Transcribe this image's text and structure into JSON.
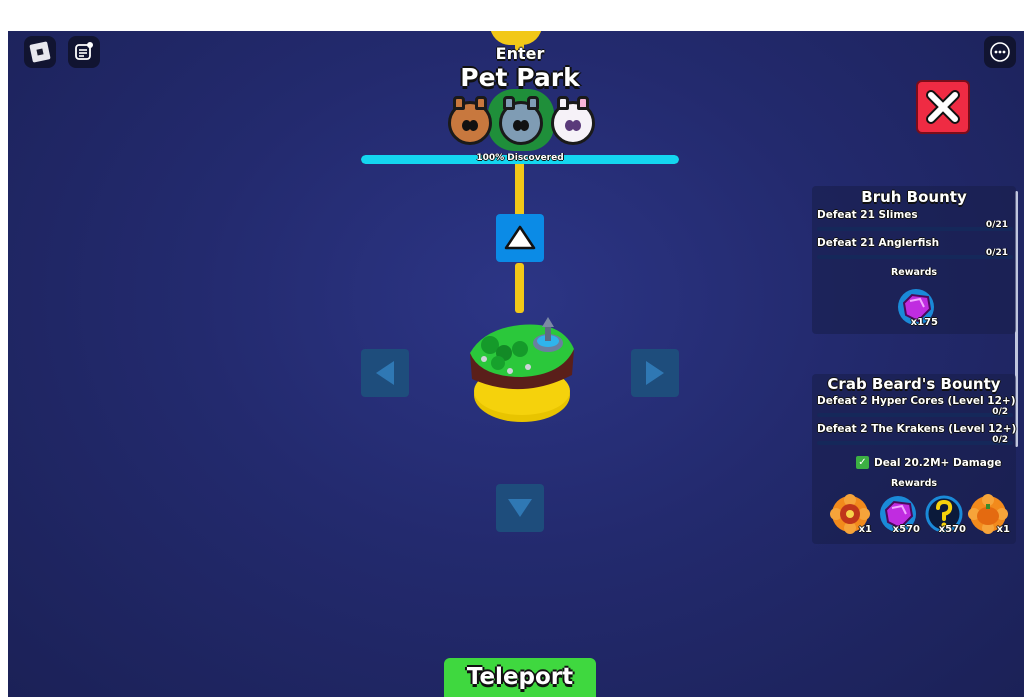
{
  "zone": {
    "enter_label": "Enter",
    "title": "Pet Park",
    "discovered_text": "100% Discovered",
    "discovered_percent": 100,
    "pets": [
      "bear-pet-icon",
      "cat-pet-icon",
      "unicorn-pet-icon"
    ]
  },
  "navigation": {
    "up": "triangle-up-icon",
    "left": "triangle-left-icon",
    "right": "triangle-right-icon",
    "down": "triangle-down-icon"
  },
  "quests": [
    {
      "title": "Bruh Bounty",
      "tasks": [
        {
          "label": "Defeat 21 Slimes",
          "count": "0/21",
          "progress": 0
        },
        {
          "label": "Defeat 21 Anglerfish",
          "count": "0/21",
          "progress": 0
        }
      ],
      "rewards_label": "Rewards",
      "rewards": [
        {
          "icon": "purple-gem-icon",
          "qty": "x175"
        }
      ]
    },
    {
      "title": "Crab Beard's Bounty",
      "tasks": [
        {
          "label": "Defeat 2 Hyper Cores (Level 12+)",
          "count": "0/2",
          "progress": 0
        },
        {
          "label": "Defeat 2 The Krakens (Level 12+)",
          "count": "0/2",
          "progress": 0
        }
      ],
      "check_item": "Deal 20.2M+ Damage",
      "rewards_label": "Rewards",
      "rewards": [
        {
          "icon": "orange-flower-egg-icon",
          "qty": "x1"
        },
        {
          "icon": "purple-gem-icon",
          "qty": "x570"
        },
        {
          "icon": "mystery-orb-icon",
          "qty": "x570"
        },
        {
          "icon": "pumpkin-flower-icon",
          "qty": "x1"
        }
      ]
    }
  ],
  "teleport_label": "Teleport",
  "colors": {
    "background": "#232a6e",
    "track": "#f2c818",
    "progress": "#14d6f0",
    "close": "#ef2b43",
    "teleport": "#3fd83f",
    "nav_active": "#0b8be6",
    "nav_inactive": "#1e4d7c"
  }
}
